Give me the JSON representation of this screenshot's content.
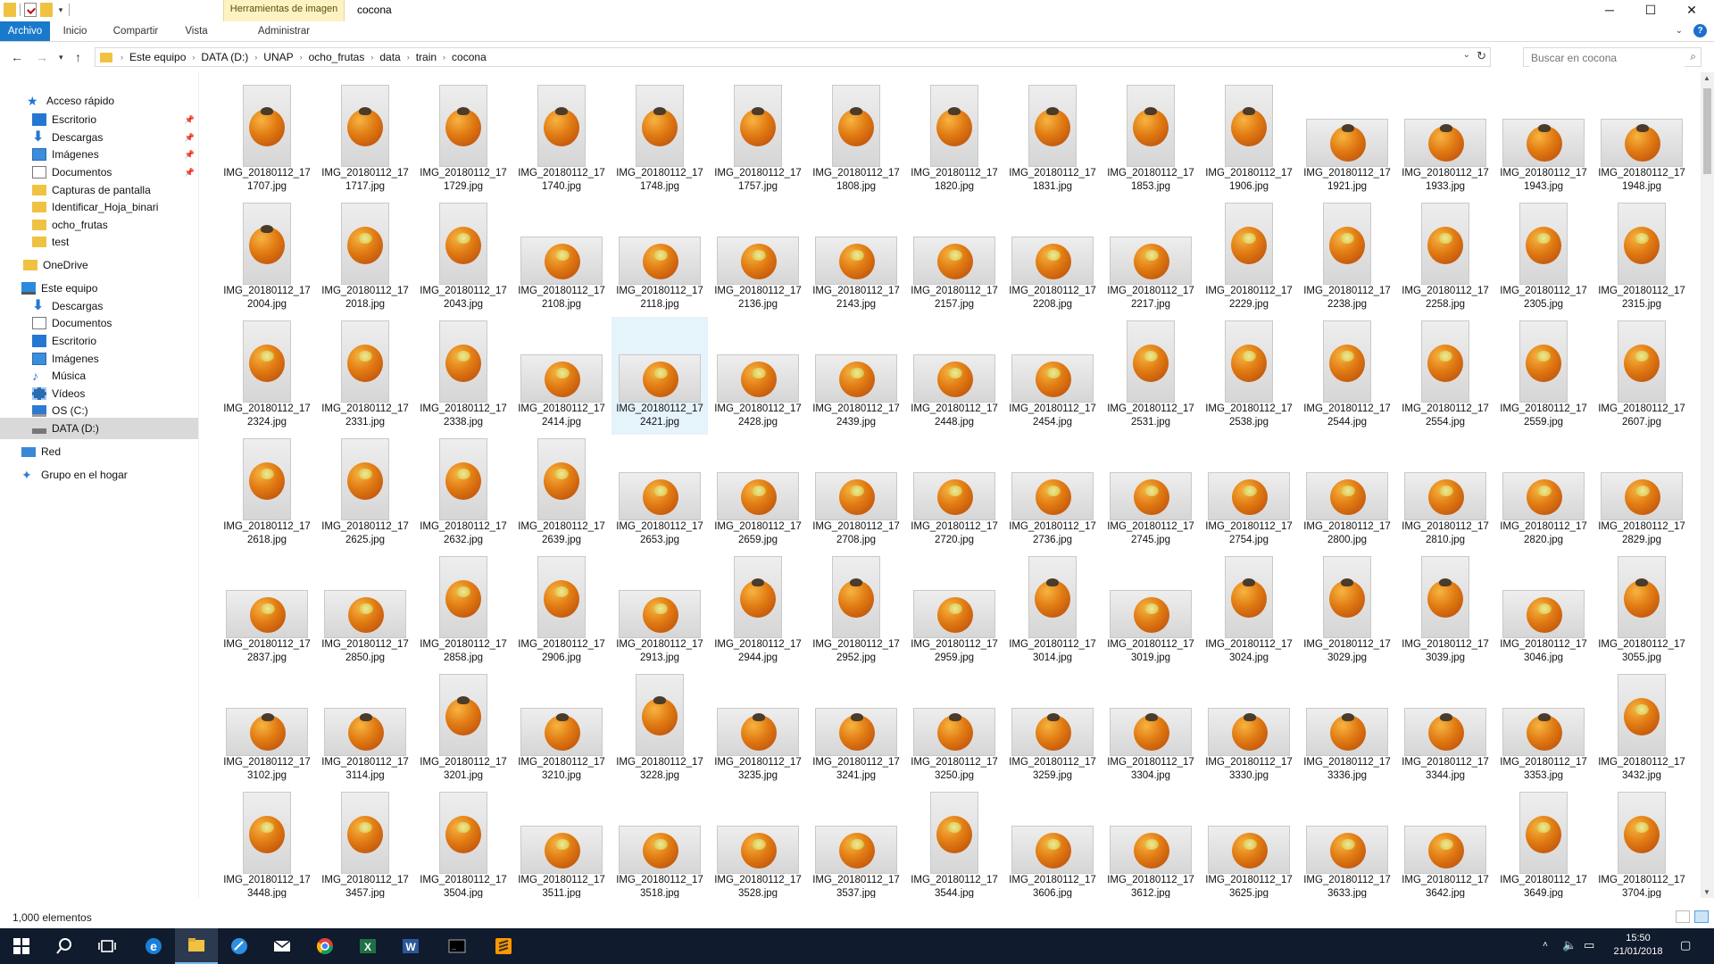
{
  "window": {
    "title": "cocona",
    "contextual_tab": "Herramientas de imagen",
    "controls": {
      "minimize": "─",
      "maximize": "☐",
      "close": "✕"
    }
  },
  "ribbon": {
    "tabs": [
      "Archivo",
      "Inicio",
      "Compartir",
      "Vista",
      "Administrar"
    ],
    "active_tab": "Archivo"
  },
  "address": {
    "breadcrumbs": [
      "Este equipo",
      "DATA (D:)",
      "UNAP",
      "ocho_frutas",
      "data",
      "train",
      "cocona"
    ]
  },
  "search": {
    "placeholder": "Buscar en cocona"
  },
  "nav": {
    "items": [
      {
        "label": "Acceso rápido",
        "icon": "star-icon"
      },
      {
        "label": "Escritorio",
        "icon": "desktop-icon",
        "pinned": true
      },
      {
        "label": "Descargas",
        "icon": "download-icon",
        "pinned": true
      },
      {
        "label": "Imágenes",
        "icon": "pictures-icon",
        "pinned": true
      },
      {
        "label": "Documentos",
        "icon": "documents-icon",
        "pinned": true
      },
      {
        "label": "Capturas de pantalla",
        "icon": "folder-icon"
      },
      {
        "label": "Identificar_Hoja_binari",
        "icon": "folder-icon"
      },
      {
        "label": "ocho_frutas",
        "icon": "folder-icon"
      },
      {
        "label": "test",
        "icon": "folder-icon"
      },
      {
        "label": "OneDrive",
        "icon": "folder-icon"
      },
      {
        "label": "Este equipo",
        "icon": "computer-icon"
      },
      {
        "label": "Descargas",
        "icon": "download-icon"
      },
      {
        "label": "Documentos",
        "icon": "documents-icon"
      },
      {
        "label": "Escritorio",
        "icon": "desktop-icon"
      },
      {
        "label": "Imágenes",
        "icon": "pictures-icon"
      },
      {
        "label": "Música",
        "icon": "music-icon"
      },
      {
        "label": "Vídeos",
        "icon": "videos-icon"
      },
      {
        "label": "OS (C:)",
        "icon": "windows-drive-icon"
      },
      {
        "label": "DATA (D:)",
        "icon": "drive-icon",
        "selected": true
      },
      {
        "label": "Red",
        "icon": "network-icon"
      },
      {
        "label": "Grupo en el hogar",
        "icon": "homegroup-icon"
      }
    ]
  },
  "files": {
    "prefix": "IMG_20180112_17",
    "suffixes": [
      "1707",
      "1717",
      "1729",
      "1740",
      "1748",
      "1757",
      "1808",
      "1820",
      "1831",
      "1853",
      "1906",
      "1921",
      "1933",
      "1943",
      "1948",
      "2004",
      "2018",
      "2043",
      "2108",
      "2118",
      "2136",
      "2143",
      "2157",
      "2208",
      "2217",
      "2229",
      "2238",
      "2258",
      "2305",
      "2315",
      "2324",
      "2331",
      "2338",
      "2414",
      "2421",
      "2428",
      "2439",
      "2448",
      "2454",
      "2531",
      "2538",
      "2544",
      "2554",
      "2559",
      "2607",
      "2618",
      "2625",
      "2632",
      "2639",
      "2653",
      "2659",
      "2708",
      "2720",
      "2736",
      "2745",
      "2754",
      "2800",
      "2810",
      "2820",
      "2829",
      "2837",
      "2850",
      "2858",
      "2906",
      "2913",
      "2944",
      "2952",
      "2959",
      "3014",
      "3019",
      "3024",
      "3029",
      "3039",
      "3046",
      "3055",
      "3102",
      "3114",
      "3201",
      "3210",
      "3228",
      "3235",
      "3241",
      "3250",
      "3259",
      "3304",
      "3330",
      "3336",
      "3344",
      "3353",
      "3432",
      "3448",
      "3457",
      "3504",
      "3511",
      "3518",
      "3528",
      "3537",
      "3544",
      "3606",
      "3612",
      "3625",
      "3633",
      "3642",
      "3649",
      "3704"
    ],
    "orientation": [
      "P",
      "P",
      "P",
      "P",
      "P",
      "P",
      "P",
      "P",
      "P",
      "P",
      "P",
      "L",
      "L",
      "L",
      "L",
      "P",
      "P",
      "P",
      "L",
      "L",
      "L",
      "L",
      "L",
      "L",
      "L",
      "P",
      "P",
      "P",
      "P",
      "P",
      "P",
      "P",
      "P",
      "L",
      "L",
      "L",
      "L",
      "L",
      "L",
      "P",
      "P",
      "P",
      "P",
      "P",
      "P",
      "P",
      "P",
      "P",
      "P",
      "L",
      "L",
      "L",
      "L",
      "L",
      "L",
      "L",
      "L",
      "L",
      "L",
      "L",
      "L",
      "L",
      "P",
      "P",
      "L",
      "P",
      "P",
      "L",
      "P",
      "L",
      "P",
      "P",
      "P",
      "L",
      "P",
      "L",
      "L",
      "P",
      "L",
      "P",
      "L",
      "L",
      "L",
      "L",
      "L",
      "L",
      "L",
      "L",
      "L",
      "P",
      "P",
      "P",
      "P",
      "L",
      "L",
      "L",
      "L",
      "P",
      "L",
      "L",
      "L",
      "L",
      "L",
      "P",
      "P"
    ],
    "selected_name": "IMG_20180112_172421.jpg",
    "extension": ".jpg"
  },
  "status": {
    "count": "1,000 elementos"
  },
  "taskbar": {
    "clock_time": "15:50",
    "clock_date": "21/01/2018",
    "apps": [
      "start-icon",
      "search-icon",
      "task-view-icon",
      "edge-icon",
      "file-explorer-icon",
      "paint-icon",
      "mail-icon",
      "chrome-icon",
      "excel-icon",
      "word-icon",
      "terminal-icon",
      "sublime-icon"
    ]
  }
}
